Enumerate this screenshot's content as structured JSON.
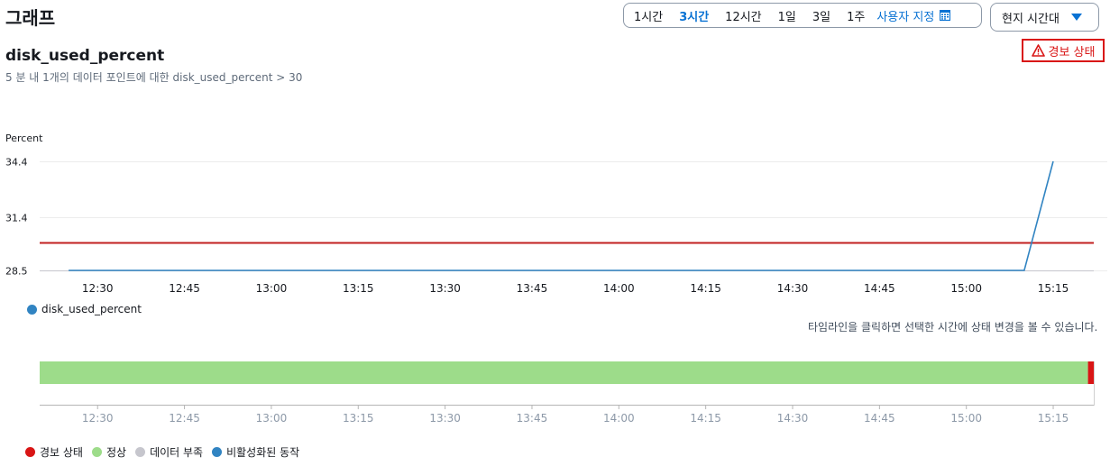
{
  "page_title": "그래프",
  "time_range": {
    "options": [
      "1시간",
      "3시간",
      "12시간",
      "1일",
      "3일",
      "1주"
    ],
    "active": "3시간",
    "custom_label": "사용자 지정"
  },
  "timezone": {
    "label": "현지 시간대"
  },
  "metric": {
    "title": "disk_used_percent",
    "subtitle": "5 분 내 1개의 데이터 포인트에 대한 disk_used_percent > 30"
  },
  "alarm_state_label": "경보 상태",
  "colors": {
    "alarm": "#d91515",
    "ok": "#9ddc8a",
    "insufficient": "#c6c6cd",
    "disabled": "#3184c2",
    "series": "#3184c2",
    "threshold": "#c11f1f"
  },
  "chart_data": {
    "type": "line",
    "ylabel": "Percent",
    "y_ticks": [
      28.5,
      31.4,
      34.4
    ],
    "ylim": [
      28.5,
      34.4
    ],
    "x_ticks": [
      "12:30",
      "12:45",
      "13:00",
      "13:15",
      "13:30",
      "13:45",
      "14:00",
      "14:15",
      "14:30",
      "14:45",
      "15:00",
      "15:15"
    ],
    "xlim": [
      "12:20",
      "15:22"
    ],
    "series": [
      {
        "name": "disk_used_percent",
        "points": [
          {
            "x": "12:25",
            "y": 28.5
          },
          {
            "x": "15:10",
            "y": 28.5
          },
          {
            "x": "15:15",
            "y": 34.4
          }
        ]
      }
    ],
    "threshold": 30
  },
  "timeline": {
    "note": "타임라인을 클릭하면 선택한 시간에 상태 변경을 볼 수 있습니다.",
    "x_ticks": [
      "12:30",
      "12:45",
      "13:00",
      "13:15",
      "13:30",
      "13:45",
      "14:00",
      "14:15",
      "14:30",
      "14:45",
      "15:00",
      "15:15"
    ],
    "segments": [
      {
        "state": "ok",
        "start": "12:20",
        "end": "15:21"
      },
      {
        "state": "alarm",
        "start": "15:21",
        "end": "15:22"
      }
    ],
    "legend": [
      {
        "state": "alarm",
        "label": "경보 상태"
      },
      {
        "state": "ok",
        "label": "정상"
      },
      {
        "state": "insufficient",
        "label": "데이터 부족"
      },
      {
        "state": "disabled",
        "label": "비활성화된 동작"
      }
    ]
  }
}
